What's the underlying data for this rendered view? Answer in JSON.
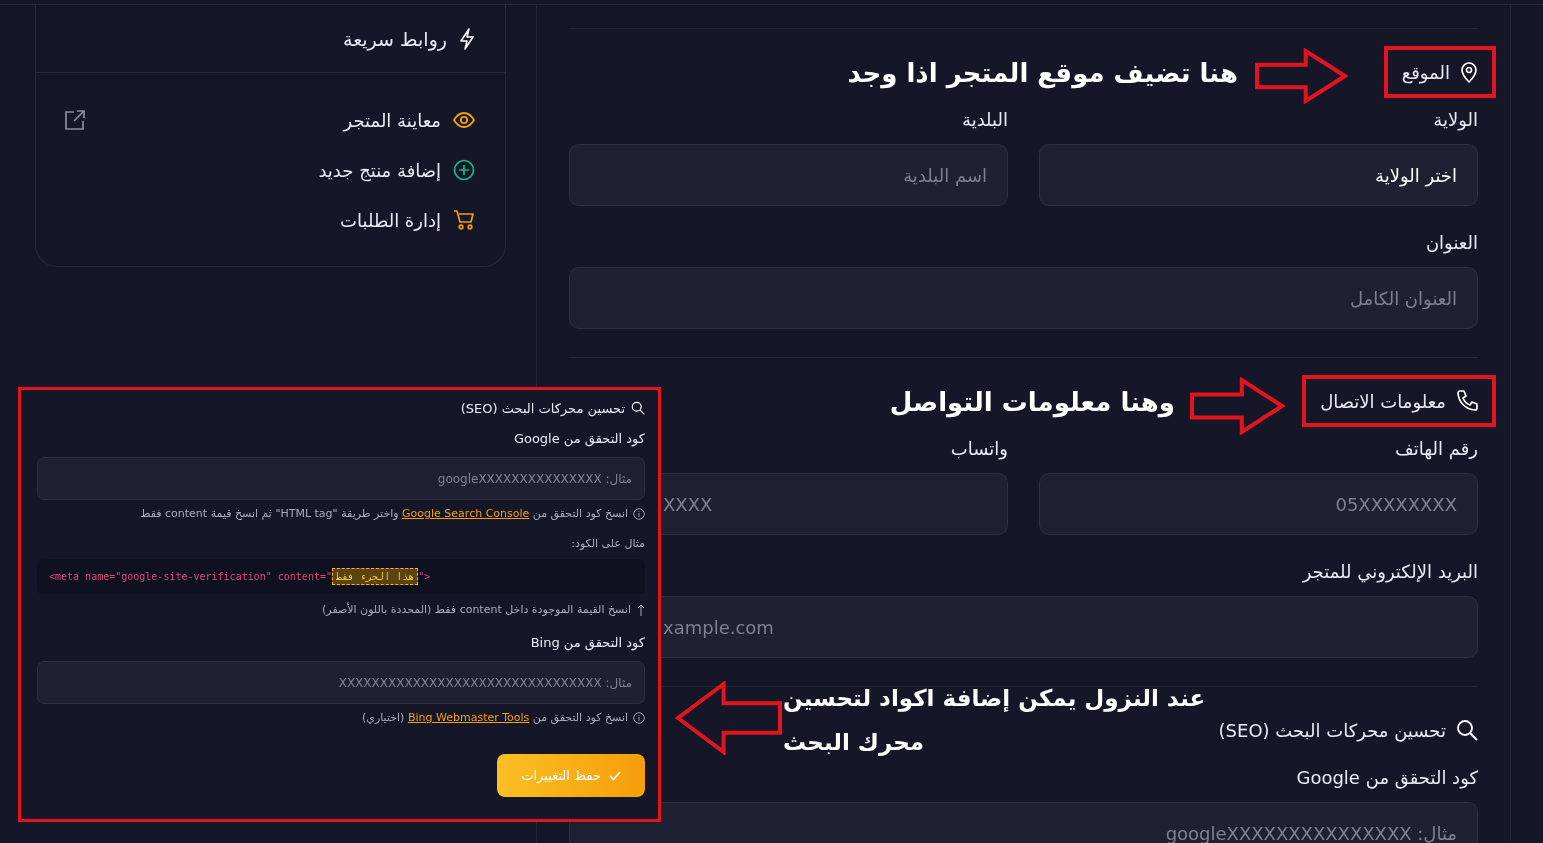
{
  "sidebar": {
    "title": "روابط سريعة",
    "items": [
      {
        "label": "معاينة المتجر",
        "kind": "preview"
      },
      {
        "label": "إضافة منتج جديد",
        "kind": "add"
      },
      {
        "label": "إدارة الطلبات",
        "kind": "orders"
      }
    ]
  },
  "form": {
    "sections": [
      {
        "title": "الموقع",
        "kind": "location",
        "highlighted": true,
        "rows": [
          [
            {
              "label": "الولاية",
              "kind": "select",
              "value": "اختر الولاية"
            },
            {
              "label": "البلدية",
              "kind": "input",
              "placeholder": "اسم البلدية"
            }
          ],
          [
            {
              "label": "العنوان",
              "kind": "input",
              "placeholder": "العنوان الكامل"
            }
          ]
        ]
      },
      {
        "title": "معلومات الاتصال",
        "kind": "contact",
        "highlighted": true,
        "rows": [
          [
            {
              "label": "رقم الهاتف",
              "kind": "input",
              "placeholder": "05XXXXXXXX"
            },
            {
              "label": "واتساب",
              "kind": "input",
              "placeholder": "XXXX",
              "covered": true
            }
          ],
          [
            {
              "label": "البريد الإلكتروني للمتجر",
              "kind": "input",
              "placeholder": "xample.com",
              "covered": true
            }
          ]
        ]
      },
      {
        "title": "تحسين محركات البحث (SEO)",
        "kind": "seo",
        "highlighted": false,
        "rows": [
          [
            {
              "label": "كود التحقق من Google",
              "kind": "input",
              "placeholder": "مثال: googleXXXXXXXXXXXXXXX"
            }
          ]
        ]
      }
    ]
  },
  "callouts": [
    {
      "text": "هنا تضيف موقع المتجر اذا وجد",
      "kind": "pointing_right"
    },
    {
      "text": "وهنا معلومات التواصل",
      "kind": "pointing_right"
    },
    {
      "text": "عند النزول يمكن إضافة اكواد لتحسين محرك البحث",
      "kind": "pointing_left"
    }
  ],
  "inset": {
    "framed": true,
    "title": "تحسين محركات البحث (SEO)",
    "google": {
      "label": "كود التحقق من Google",
      "placeholder": "مثال: googleXXXXXXXXXXXXXXX",
      "hint_before": "انسخ كود التحقق من",
      "link": "Google Search Console",
      "hint_after": "واختر طريقة \"HTML tag\" ثم انسخ قيمة content فقط"
    },
    "example_label": "مثال على الكود:",
    "code": {
      "before": "<meta name=\"google-site-verification\" content=\"",
      "highlight": "هذا الجزء فقط",
      "after": "\">"
    },
    "code_note": "انسخ القيمة الموجودة داخل content فقط (المحددة باللون الأصفر)",
    "bing": {
      "label": "كود التحقق من Bing",
      "placeholder": "مثال: XXXXXXXXXXXXXXXXXXXXXXXXXXXXXXXX",
      "hint_before": "انسخ كود التحقق من",
      "link": "Bing Webmaster Tools",
      "hint_after": "(اختياري)"
    },
    "save": "حفظ التغييرات"
  }
}
